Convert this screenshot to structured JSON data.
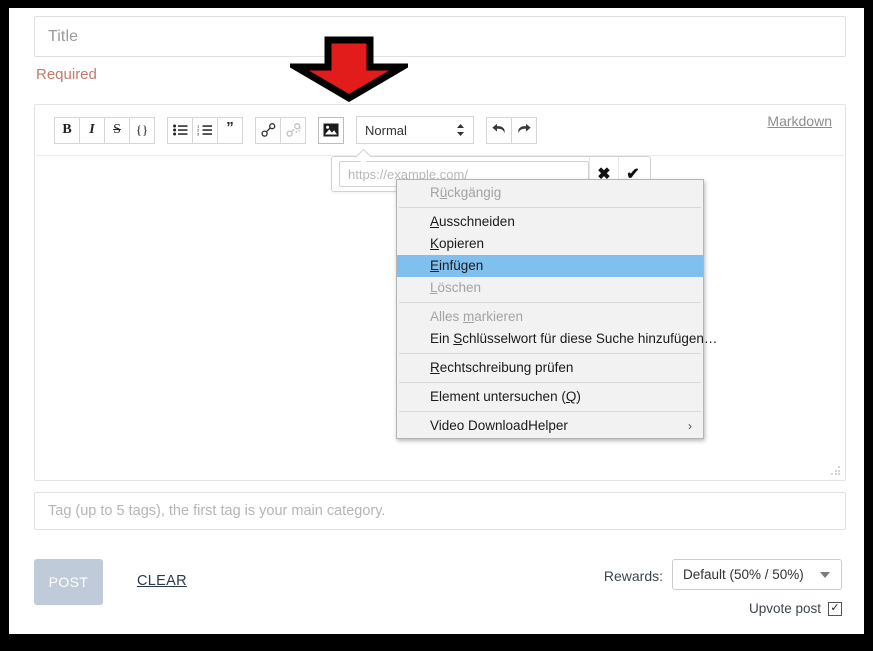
{
  "title_field": {
    "placeholder": "Title",
    "value": ""
  },
  "required_note": "Required",
  "editor": {
    "markdown_link": "Markdown",
    "toolbar": {
      "bold": "B",
      "italic": "I",
      "strikethrough": "S",
      "code": "{}",
      "bullet_list": "bullet-list-icon",
      "ordered_list": "ordered-list-icon",
      "quote": "”",
      "link": "link-icon",
      "unlink": "unlink-icon",
      "image": "image-icon",
      "format_value": "Normal",
      "undo": "undo-icon",
      "redo": "redo-icon"
    },
    "url_bubble": {
      "placeholder": "https://example.com/",
      "value": "",
      "cancel": "✖",
      "confirm": "✔"
    }
  },
  "context_menu": {
    "items": [
      {
        "label": "Rückgängig",
        "accel": "ü",
        "disabled": true,
        "selected": false,
        "submenu": false,
        "sep_after": true
      },
      {
        "label": "Ausschneiden",
        "accel": "A",
        "disabled": false,
        "selected": false,
        "submenu": false,
        "sep_after": false
      },
      {
        "label": "Kopieren",
        "accel": "K",
        "disabled": false,
        "selected": false,
        "submenu": false,
        "sep_after": false
      },
      {
        "label": "Einfügen",
        "accel": "E",
        "disabled": false,
        "selected": true,
        "submenu": false,
        "sep_after": false
      },
      {
        "label": "Löschen",
        "accel": "L",
        "disabled": true,
        "selected": false,
        "submenu": false,
        "sep_after": true
      },
      {
        "label": "Alles markieren",
        "accel": "m",
        "disabled": true,
        "selected": false,
        "submenu": false,
        "sep_after": false
      },
      {
        "label": "Ein Schlüsselwort für diese Suche hinzufügen…",
        "accel": "S",
        "disabled": false,
        "selected": false,
        "submenu": false,
        "sep_after": true
      },
      {
        "label": "Rechtschreibung prüfen",
        "accel": "R",
        "disabled": false,
        "selected": false,
        "submenu": false,
        "sep_after": true
      },
      {
        "label": "Element untersuchen (Q)",
        "accel": "Q",
        "disabled": false,
        "selected": false,
        "submenu": false,
        "sep_after": true
      },
      {
        "label": "Video DownloadHelper",
        "accel": "",
        "disabled": false,
        "selected": false,
        "submenu": true,
        "sep_after": false
      }
    ],
    "submenu_arrow": "›"
  },
  "tag_field": {
    "placeholder": "Tag (up to 5 tags), the first tag is your main category.",
    "value": ""
  },
  "footer": {
    "post_label": "POST",
    "clear_label": "CLEAR",
    "rewards_label": "Rewards:",
    "rewards_value": "Default (50% / 50%)",
    "upvote_label": "Upvote post",
    "upvote_checked": true,
    "upvote_mark": "✓"
  },
  "annotation": {
    "arrow": "red-down-arrow",
    "arrow_color": "#e21b1b",
    "arrow_outline": "#000000"
  },
  "colors": {
    "required": "#c4796c",
    "menu_highlight": "#80c0ef",
    "post_button": "#bfcbd8",
    "frame": "#000000"
  }
}
